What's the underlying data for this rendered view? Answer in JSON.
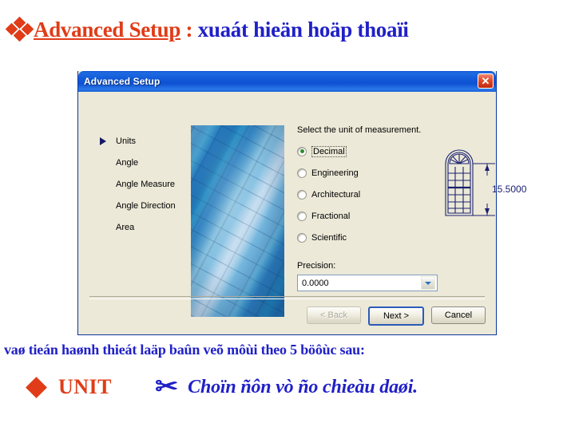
{
  "slide": {
    "title_bullet_icon": "four-diamonds-icon",
    "title_main": "Advanced Setup",
    "title_separator": " : ",
    "title_vietnamese": "xuaát hieän hoäp thoaïi",
    "bottom_line": "vaø tieán haønh thieát laäp baûn veõ môùi theo 5 böôùc sau:",
    "unit_bullet_icon": "diamond-bullet-icon",
    "unit_label": "UNIT",
    "scissors_icon": "scissors-icon",
    "scissors_glyph": "✂",
    "unit_note": "Choïn ñôn vò ño chieàu daøi."
  },
  "dialog": {
    "title": "Advanced Setup",
    "close_label": "✕",
    "nav": {
      "items": [
        {
          "label": "Units",
          "selected": true
        },
        {
          "label": "Angle",
          "selected": false
        },
        {
          "label": "Angle Measure",
          "selected": false
        },
        {
          "label": "Angle Direction",
          "selected": false
        },
        {
          "label": "Area",
          "selected": false
        }
      ]
    },
    "image": {
      "name": "blueprint-rolls-photo",
      "description": "Rolled blue architectural blueprints"
    },
    "options": {
      "heading": "Select the unit of measurement.",
      "radios": [
        {
          "label": "Decimal",
          "mnemonic": "D",
          "checked": true
        },
        {
          "label": "Engineering",
          "mnemonic": "E",
          "checked": false
        },
        {
          "label": "Architectural",
          "mnemonic": "A",
          "checked": false
        },
        {
          "label": "Fractional",
          "mnemonic": "F",
          "checked": false
        },
        {
          "label": "Scientific",
          "mnemonic": "S",
          "checked": false
        }
      ]
    },
    "preview": {
      "name": "arched-window-preview",
      "dimension_value": "15.5000"
    },
    "precision": {
      "label": "Precision:",
      "mnemonic": "P",
      "value": "0.0000"
    },
    "buttons": {
      "back": {
        "label": "< Back",
        "disabled": true,
        "default": false
      },
      "next": {
        "label": "Next >",
        "disabled": false,
        "default": true
      },
      "cancel": {
        "label": "Cancel",
        "disabled": false,
        "default": false
      }
    }
  },
  "colors": {
    "red": "#E03C18",
    "blue": "#2020C8",
    "titlebar_blue": "#1259D8",
    "dialog_face": "#ECE9D8",
    "drawing_navy": "#151B66"
  }
}
